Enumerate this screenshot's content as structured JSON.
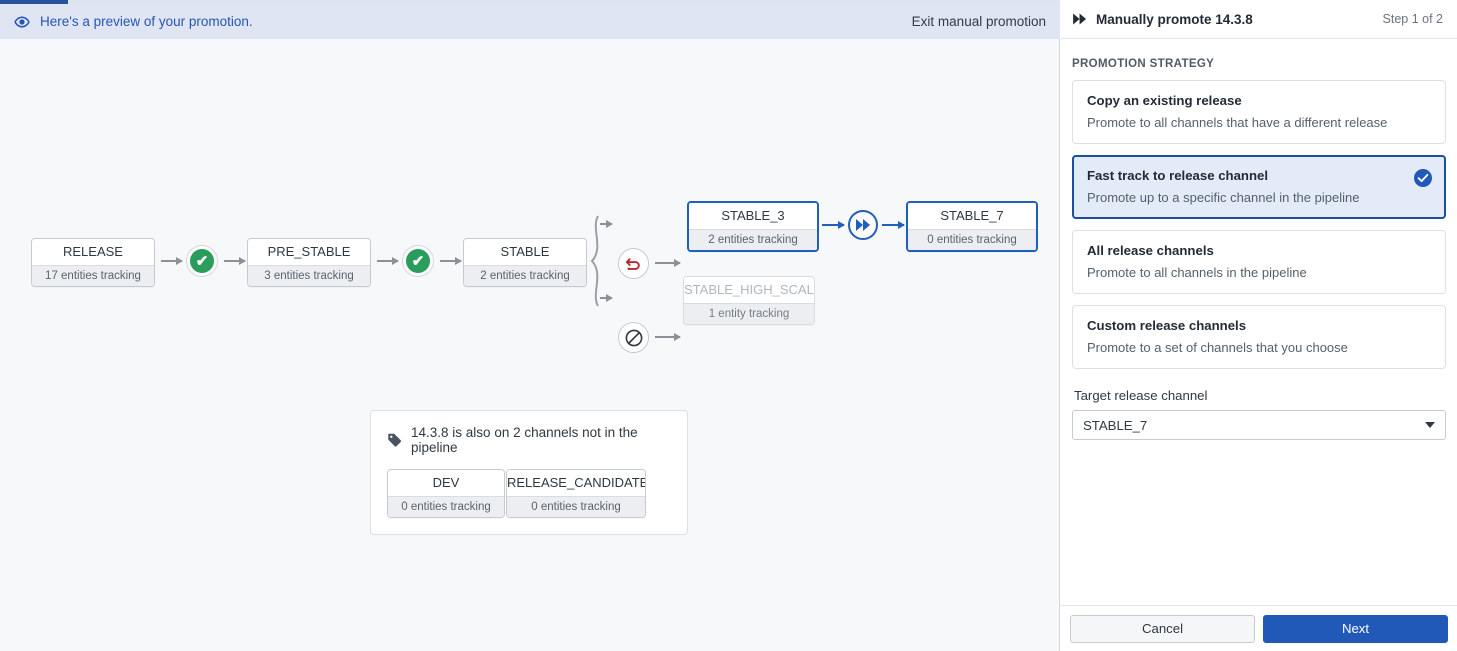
{
  "banner": {
    "eye_icon": "eye-icon",
    "message": "Here's a preview of your promotion.",
    "exit_label": "Exit manual promotion"
  },
  "pipeline": {
    "nodes": [
      {
        "name": "RELEASE",
        "sub": "17 entities tracking",
        "state": "normal"
      },
      {
        "name": "PRE_STABLE",
        "sub": "3 entities tracking",
        "state": "normal"
      },
      {
        "name": "STABLE",
        "sub": "2 entities tracking",
        "state": "normal"
      },
      {
        "name": "STABLE_3",
        "sub": "2 entities tracking",
        "state": "selected"
      },
      {
        "name": "STABLE_HIGH_SCALE",
        "sub": "1 entity tracking",
        "state": "disabled"
      },
      {
        "name": "STABLE_7",
        "sub": "0 entities tracking",
        "state": "selected"
      }
    ],
    "gates": [
      {
        "icon": "check-circle-icon",
        "style": "green"
      },
      {
        "icon": "check-circle-icon",
        "style": "green"
      },
      {
        "icon": "rollback-icon",
        "style": "outline"
      },
      {
        "icon": "blocked-icon",
        "style": "outline"
      },
      {
        "icon": "fast-forward-icon",
        "style": "blue"
      }
    ]
  },
  "extra_channels": {
    "tag_icon": "tag-icon",
    "heading": "14.3.8 is also on 2 channels not in the pipeline",
    "nodes": [
      {
        "name": "DEV",
        "sub": "0 entities tracking"
      },
      {
        "name": "RELEASE_CANDIDATE",
        "sub": "0 entities tracking"
      }
    ]
  },
  "panel": {
    "icon": "fast-forward-icon",
    "title": "Manually promote 14.3.8",
    "step": "Step 1 of 2",
    "section_label": "PROMOTION STRATEGY",
    "strategies": [
      {
        "title": "Copy an existing release",
        "desc": "Promote to all channels that have a different release",
        "selected": false
      },
      {
        "title": "Fast track to release channel",
        "desc": "Promote up to a specific channel in the pipeline",
        "selected": true
      },
      {
        "title": "All release channels",
        "desc": "Promote to all channels in the pipeline",
        "selected": false
      },
      {
        "title": "Custom release channels",
        "desc": "Promote to a set of channels that you choose",
        "selected": false
      }
    ],
    "target_label": "Target release channel",
    "target_value": "STABLE_7",
    "cancel_label": "Cancel",
    "next_label": "Next"
  },
  "colors": {
    "accent": "#2159b8",
    "selected_border": "#1b4f9c",
    "selected_bg": "#e4ebf8",
    "banner_bg": "#dfe5f3",
    "banner_text": "#2556b5",
    "green": "#2a9d5c",
    "red": "#b52a30",
    "canvas_bg": "#f7f8fa"
  }
}
